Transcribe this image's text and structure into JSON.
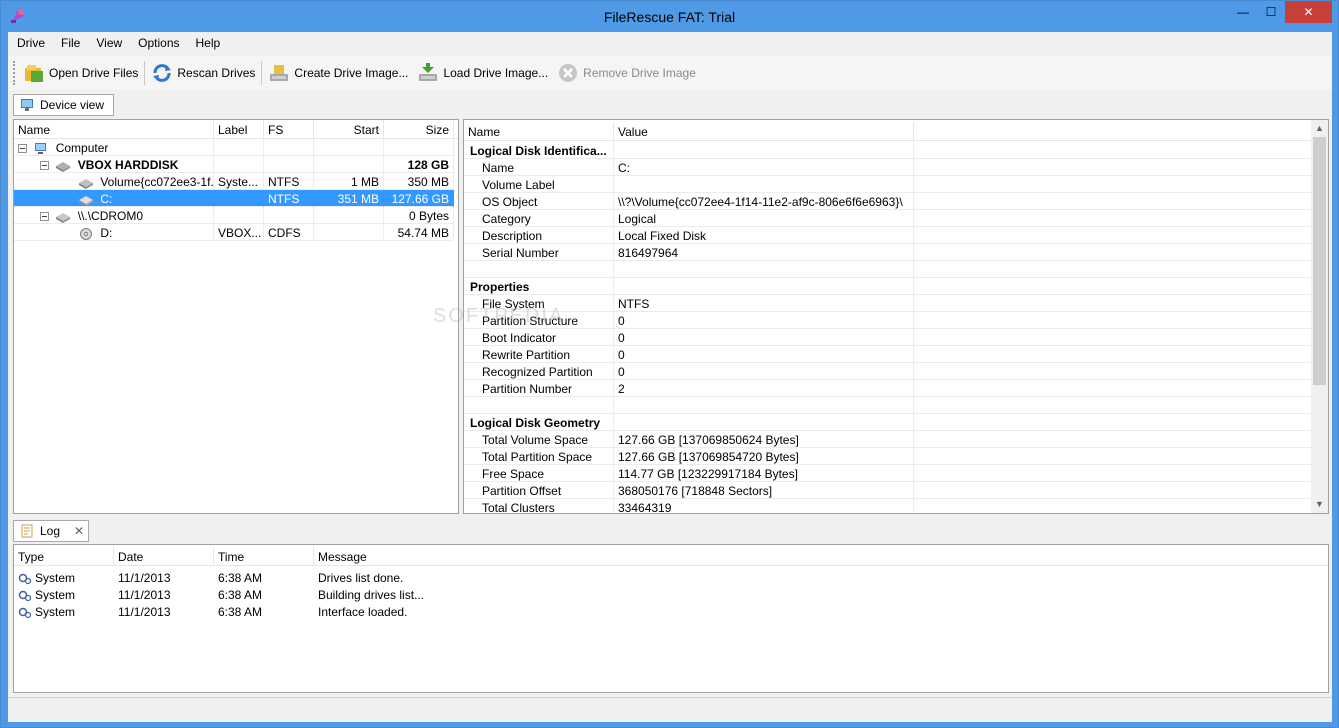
{
  "window": {
    "title": "FileRescue FAT: Trial",
    "close_glyph": "✕",
    "min_glyph": "—",
    "max_glyph": "☐"
  },
  "menu": [
    "Drive",
    "File",
    "View",
    "Options",
    "Help"
  ],
  "toolbar": {
    "open_drive_files": "Open Drive Files",
    "rescan_drives": "Rescan Drives",
    "create_drive_image": "Create Drive Image...",
    "load_drive_image": "Load Drive Image...",
    "remove_drive_image": "Remove Drive Image"
  },
  "device_view_tab": "Device view",
  "tree": {
    "headers": {
      "name": "Name",
      "label": "Label",
      "fs": "FS",
      "start": "Start",
      "size": "Size"
    },
    "rows": [
      {
        "name": "Computer",
        "label": "",
        "fs": "",
        "start": "",
        "size": ""
      },
      {
        "name": "VBOX HARDDISK",
        "label": "",
        "fs": "",
        "start": "",
        "size": "128 GB"
      },
      {
        "name": "Volume{cc072ee3-1f...",
        "label": "Syste...",
        "fs": "NTFS",
        "start": "1 MB",
        "size": "350 MB"
      },
      {
        "name": "C:",
        "label": "",
        "fs": "NTFS",
        "start": "351 MB",
        "size": "127.66 GB"
      },
      {
        "name": "\\\\.\\CDROM0",
        "label": "",
        "fs": "",
        "start": "",
        "size": "0 Bytes"
      },
      {
        "name": "D:",
        "label": "VBOX...",
        "fs": "CDFS",
        "start": "",
        "size": "54.74 MB"
      }
    ]
  },
  "props": {
    "headers": {
      "name": "Name",
      "value": "Value"
    },
    "rows": [
      {
        "name": "Logical Disk Identifica...",
        "value": "",
        "section": true
      },
      {
        "name": "Name",
        "value": "C:"
      },
      {
        "name": "Volume Label",
        "value": ""
      },
      {
        "name": "OS Object",
        "value": "\\\\?\\Volume{cc072ee4-1f14-11e2-af9c-806e6f6e6963}\\"
      },
      {
        "name": "Category",
        "value": "Logical"
      },
      {
        "name": "Description",
        "value": "Local Fixed Disk"
      },
      {
        "name": "Serial Number",
        "value": "816497964"
      },
      {
        "name": "",
        "value": ""
      },
      {
        "name": "Properties",
        "value": "",
        "section": true
      },
      {
        "name": "File System",
        "value": "NTFS"
      },
      {
        "name": "Partition Structure",
        "value": "0"
      },
      {
        "name": "Boot Indicator",
        "value": "0"
      },
      {
        "name": "Rewrite Partition",
        "value": "0"
      },
      {
        "name": "Recognized Partition",
        "value": "0"
      },
      {
        "name": "Partition Number",
        "value": "2"
      },
      {
        "name": "",
        "value": ""
      },
      {
        "name": "Logical Disk Geometry",
        "value": "",
        "section": true
      },
      {
        "name": "Total Volume Space",
        "value": "127.66 GB [137069850624 Bytes]"
      },
      {
        "name": "Total Partition Space",
        "value": "127.66 GB [137069854720 Bytes]"
      },
      {
        "name": "Free Space",
        "value": "114.77 GB [123229917184 Bytes]"
      },
      {
        "name": "Partition Offset",
        "value": "368050176 [718848 Sectors]"
      },
      {
        "name": "Total Clusters",
        "value": "33464319"
      }
    ]
  },
  "log_tab": {
    "label": "Log",
    "close_glyph": "✕"
  },
  "log": {
    "headers": {
      "type": "Type",
      "date": "Date",
      "time": "Time",
      "message": "Message"
    },
    "rows": [
      {
        "type": "System",
        "date": "11/1/2013",
        "time": "6:38 AM",
        "message": "Drives list done."
      },
      {
        "type": "System",
        "date": "11/1/2013",
        "time": "6:38 AM",
        "message": "Building drives list..."
      },
      {
        "type": "System",
        "date": "11/1/2013",
        "time": "6:38 AM",
        "message": "Interface loaded."
      }
    ]
  },
  "watermark": "SOFTPEDIA",
  "scroll_arrows": {
    "up": "▲",
    "down": "▼"
  },
  "colors": {
    "selection": "#3399ff",
    "titlebar": "#4f9ae6",
    "close_button": "#c7403a"
  }
}
